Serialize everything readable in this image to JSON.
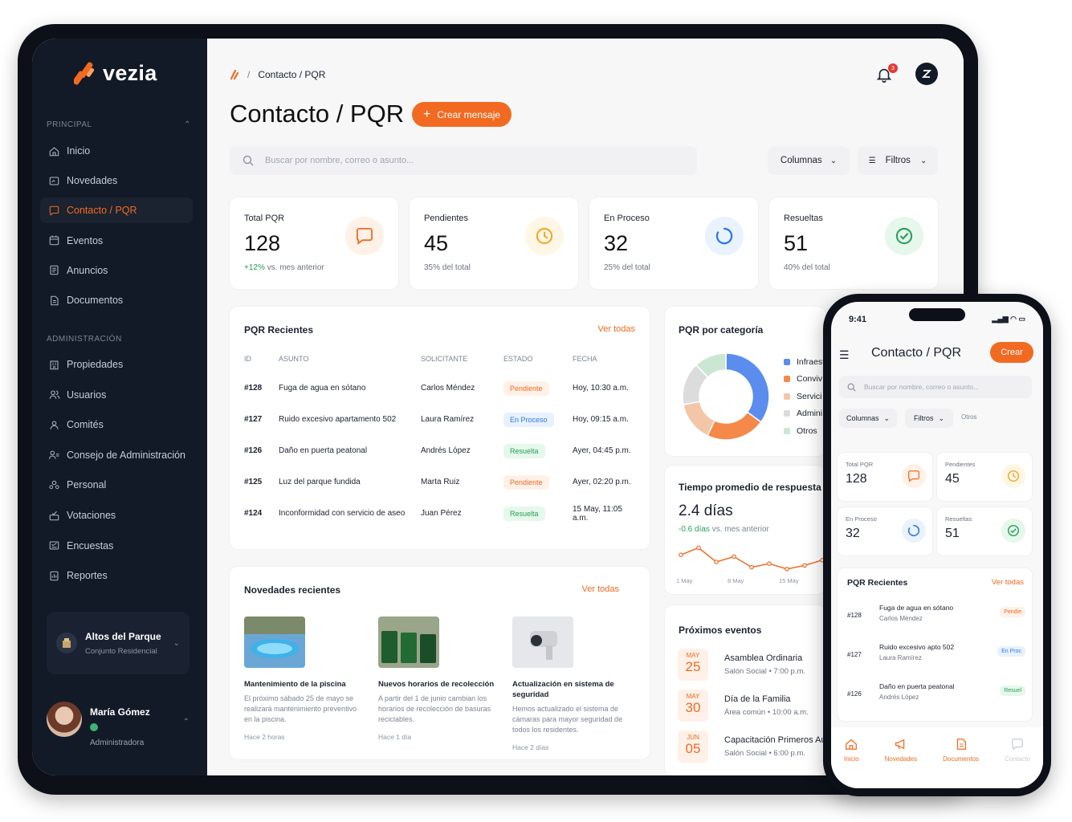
{
  "brand": {
    "name": "vezia",
    "accent": "#f26a21",
    "sidebar_bg": "#121a28"
  },
  "sidebar": {
    "principal_title": "PRINCIPAL",
    "principal": [
      {
        "label": "Inicio",
        "icon": "home-icon"
      },
      {
        "label": "Novedades",
        "icon": "news-icon"
      },
      {
        "label": "Contacto / PQR",
        "icon": "chat-icon",
        "active": true
      },
      {
        "label": "Eventos",
        "icon": "calendar-icon"
      },
      {
        "label": "Anuncios",
        "icon": "announcement-icon"
      },
      {
        "label": "Documentos",
        "icon": "document-icon"
      }
    ],
    "admin_title": "ADMINISTRACIÓN",
    "admin": [
      {
        "label": "Propiedades",
        "icon": "building-icon"
      },
      {
        "label": "Usuarios",
        "icon": "users-icon"
      },
      {
        "label": "Comités",
        "icon": "group-icon"
      },
      {
        "label": "Consejo de Administración",
        "icon": "council-icon"
      },
      {
        "label": "Personal",
        "icon": "staff-icon"
      },
      {
        "label": "Votaciones",
        "icon": "vote-icon"
      },
      {
        "label": "Encuestas",
        "icon": "survey-icon"
      },
      {
        "label": "Reportes",
        "icon": "report-icon"
      }
    ],
    "property": {
      "name": "Altos del Parque",
      "type": "Conjunto Residencial"
    },
    "user": {
      "name": "María Gómez",
      "role": "Administradora"
    }
  },
  "header": {
    "breadcrumb_sep": "/",
    "breadcrumb": "Contacto / PQR",
    "notif_count": "3",
    "title": "Contacto / PQR",
    "create_button": "Crear mensaje"
  },
  "toolbar": {
    "search_placeholder": "Buscar por nombre, correo o asunto...",
    "columns": "Columnas",
    "filters": "Filtros"
  },
  "stats": [
    {
      "label": "Total PQR",
      "value": "128",
      "sub_highlight": "+12%",
      "sub": " vs. mes anterior",
      "icon": "chat-icon",
      "color": "#f26a21",
      "bg": "#fff1e8"
    },
    {
      "label": "Pendientes",
      "value": "45",
      "sub_highlight": "",
      "sub": "35% del total",
      "icon": "clock-icon",
      "color": "#f5a623",
      "bg": "#fff7e6"
    },
    {
      "label": "En Proceso",
      "value": "32",
      "sub_highlight": "",
      "sub": "25% del total",
      "icon": "spinner-icon",
      "color": "#2d7be5",
      "bg": "#eaf2fe"
    },
    {
      "label": "Resueltas",
      "value": "51",
      "sub_highlight": "",
      "sub": "40% del total",
      "icon": "check-circle-icon",
      "color": "#27a058",
      "bg": "#e6f7ec"
    }
  ],
  "recent": {
    "title": "PQR Recientes",
    "link": "Ver todas",
    "columns": [
      "ID",
      "ASUNTO",
      "SOLICITANTE",
      "ESTADO",
      "FECHA"
    ],
    "rows": [
      {
        "id": "#128",
        "subject": "Fuga de agua en sótano",
        "requester": "Carlos Méndez",
        "status": "Pendiente",
        "cls": "b-pend",
        "date": "Hoy, 10:30 a.m."
      },
      {
        "id": "#127",
        "subject": "Ruido excesivo apartamento 502",
        "requester": "Laura Ramírez",
        "status": "En Proceso",
        "cls": "b-proc",
        "date": "Hoy, 09:15 a.m."
      },
      {
        "id": "#126",
        "subject": "Daño en puerta peatonal",
        "requester": "Andrés López",
        "status": "Resuelta",
        "cls": "b-res",
        "date": "Ayer, 04:45 p.m."
      },
      {
        "id": "#125",
        "subject": "Luz del parque fundida",
        "requester": "Marta Ruiz",
        "status": "Pendiente",
        "cls": "b-pend",
        "date": "Ayer, 02:20 p.m."
      },
      {
        "id": "#124",
        "subject": "Inconformidad con servicio de aseo",
        "requester": "Juan Pérez",
        "status": "Resuelta",
        "cls": "b-res",
        "date": "15 May, 11:05 a.m."
      }
    ]
  },
  "category": {
    "title": "PQR por categoría",
    "legend": [
      {
        "label": "Infraest",
        "color": "#5b8def",
        "share": 0.35
      },
      {
        "label": "Conviv",
        "color": "#f5894a",
        "share": 0.22
      },
      {
        "label": "Servici",
        "color": "#f4c6a8",
        "share": 0.15
      },
      {
        "label": "Admini",
        "color": "#dcdcdc",
        "share": 0.16
      },
      {
        "label": "Otros",
        "color": "#cbe6d3",
        "share": 0.12
      }
    ]
  },
  "response": {
    "title": "Tiempo promedio de respuesta",
    "value": "2.4 días",
    "delta": "-0.6 días",
    "delta_suffix": " vs. mes anterior",
    "ticks": [
      "1 May",
      "8 May",
      "15 May"
    ],
    "points": [
      3.0,
      3.4,
      2.6,
      2.9,
      2.3,
      2.5,
      2.2,
      2.4,
      2.7
    ]
  },
  "news": {
    "title": "Novedades recientes",
    "link": "Ver todas",
    "items": [
      {
        "title": "Mantenimiento de la piscina",
        "body": "El próximo sábado 25 de mayo se realizará mantenimiento preventivo en la piscina.",
        "time": "Hace 2 horas",
        "img": "pool-image"
      },
      {
        "title": "Nuevos horarios de recolección",
        "body": "A partir del 1 de junio cambian los horarios de recolección de basuras reciclables.",
        "time": "Hace 1 día",
        "img": "bins-image"
      },
      {
        "title": "Actualización en sistema de seguridad",
        "body": "Hemos actualizado el sistema de cámaras para mayor seguridad de todos los residentes.",
        "time": "Hace 2 días",
        "img": "camera-image"
      }
    ]
  },
  "events": {
    "title": "Próximos eventos",
    "items": [
      {
        "month": "MAY",
        "day": "25",
        "title": "Asamblea Ordinaria",
        "place": "Salón Social • 7:00 p.m."
      },
      {
        "month": "MAY",
        "day": "30",
        "title": "Día de la Familia",
        "place": "Área común • 10:00 a.m."
      },
      {
        "month": "JUN",
        "day": "05",
        "title": "Capacitación Primeros Au",
        "place": "Salón Social • 6:00 p.m."
      }
    ]
  },
  "phone": {
    "time": "9:41",
    "title": "Contacto / PQR",
    "create": "Crear",
    "search_placeholder": "Buscar por nombre, correo o asunto...",
    "columns": "Columnas",
    "filters": "Filtros",
    "more": "Otros",
    "stats": [
      {
        "label": "Total PQR",
        "value": "128",
        "icon": "chat-icon",
        "color": "#f26a21",
        "bg": "#fff1e8"
      },
      {
        "label": "Pendientes",
        "value": "45",
        "icon": "clock-icon",
        "color": "#f5a623",
        "bg": "#fff7e6"
      },
      {
        "label": "En Proceso",
        "value": "32",
        "icon": "spinner-icon",
        "color": "#2d7be5",
        "bg": "#eaf2fe"
      },
      {
        "label": "Resueltas",
        "value": "51",
        "icon": "check-circle-icon",
        "color": "#27a058",
        "bg": "#e6f7ec"
      }
    ],
    "recent_title": "PQR Recientes",
    "recent_link": "Ver todas",
    "rows": [
      {
        "id": "#128",
        "subject": "Fuga de agua en sótano",
        "requester": "Carlos Méndez",
        "status": "Pendie",
        "cls": "b-pend"
      },
      {
        "id": "#127",
        "subject": "Ruido excesivo apto 502",
        "requester": "Laura Ramírez",
        "status": "En Proc",
        "cls": "b-proc"
      },
      {
        "id": "#126",
        "subject": "Daño en puerta peatonal",
        "requester": "Andrés López",
        "status": "Resuel",
        "cls": "b-res"
      }
    ],
    "tabs": [
      {
        "label": "Inicio",
        "icon": "home-icon"
      },
      {
        "label": "Novedades",
        "icon": "megaphone-icon"
      },
      {
        "label": "Documentos",
        "icon": "document-icon"
      },
      {
        "label": "Contacto",
        "icon": "chat-icon"
      }
    ]
  }
}
